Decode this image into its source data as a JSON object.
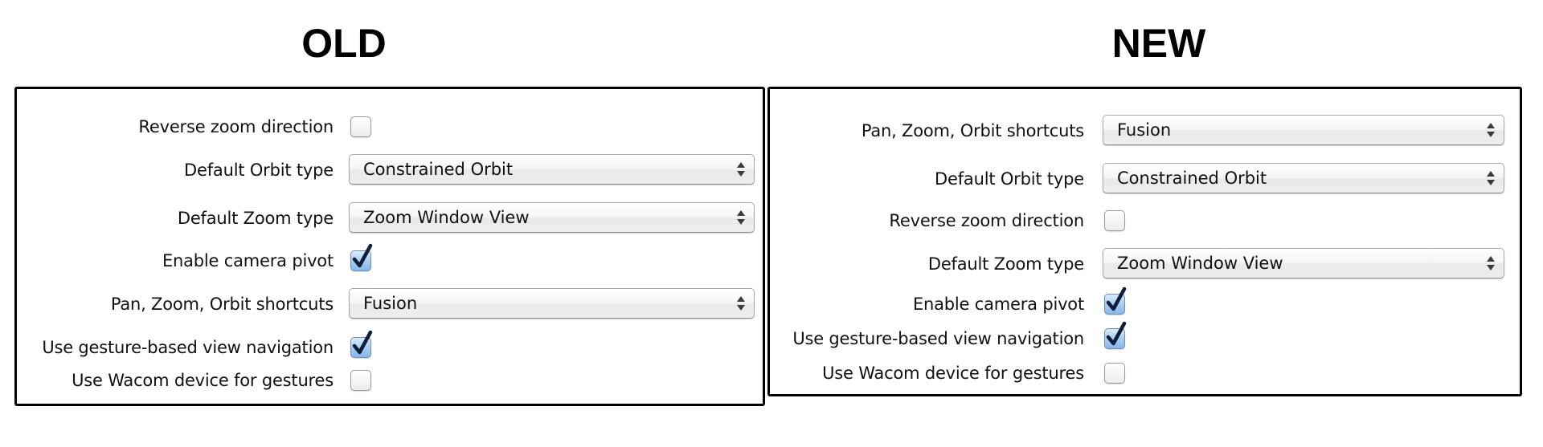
{
  "headings": {
    "old": "OLD",
    "new": "NEW"
  },
  "icons": {
    "select_arrows": "up-down-arrows-icon",
    "check": "checkmark-icon"
  },
  "colors": {
    "check_fill": "#a9cdf1",
    "checkmark": "#0f1e3a",
    "panel_border": "#000000"
  },
  "old_panel": {
    "rows": [
      {
        "type": "checkbox",
        "label": "Reverse zoom direction",
        "checked": false
      },
      {
        "type": "select",
        "label": "Default Orbit type",
        "value": "Constrained Orbit"
      },
      {
        "type": "select",
        "label": "Default Zoom type",
        "value": "Zoom Window View"
      },
      {
        "type": "checkbox",
        "label": "Enable camera pivot",
        "checked": true
      },
      {
        "type": "select",
        "label": "Pan, Zoom, Orbit shortcuts",
        "value": "Fusion"
      },
      {
        "type": "checkbox",
        "label": "Use gesture-based view navigation",
        "checked": true
      },
      {
        "type": "checkbox",
        "label": "Use Wacom device for gestures",
        "checked": false
      }
    ]
  },
  "new_panel": {
    "rows": [
      {
        "type": "select",
        "label": "Pan, Zoom, Orbit shortcuts",
        "value": "Fusion"
      },
      {
        "type": "select",
        "label": "Default Orbit type",
        "value": "Constrained Orbit"
      },
      {
        "type": "checkbox",
        "label": "Reverse zoom direction",
        "checked": false
      },
      {
        "type": "select",
        "label": "Default Zoom type",
        "value": "Zoom Window View"
      },
      {
        "type": "checkbox",
        "label": "Enable camera pivot",
        "checked": true
      },
      {
        "type": "checkbox",
        "label": "Use gesture-based view navigation",
        "checked": true
      },
      {
        "type": "checkbox",
        "label": "Use Wacom device for gestures",
        "checked": false
      }
    ]
  }
}
